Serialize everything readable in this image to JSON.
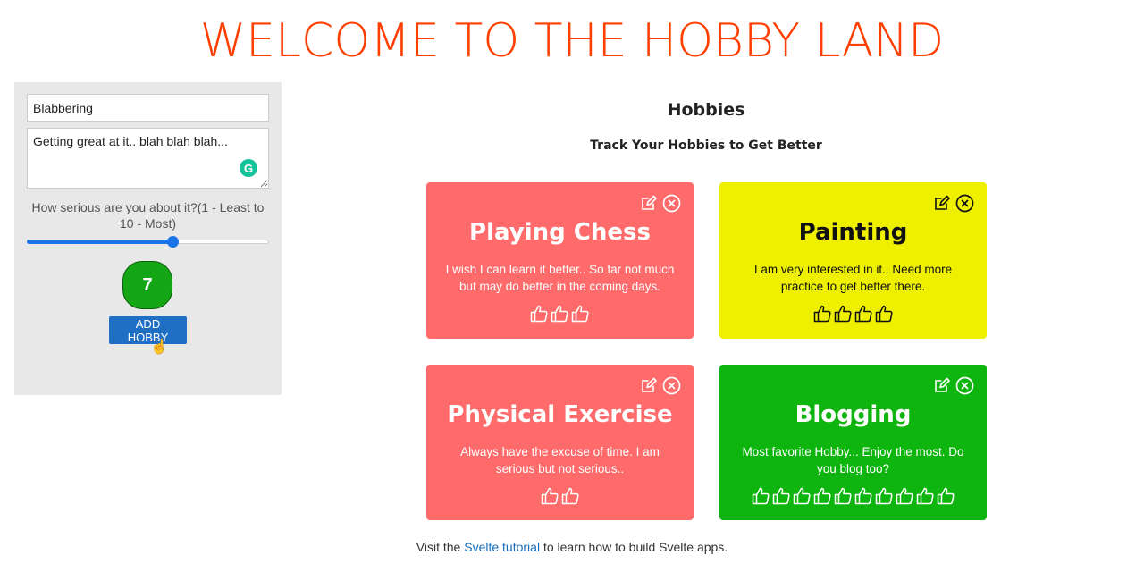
{
  "page": {
    "title": "WELCOME TO THE HOBBY LAND"
  },
  "form": {
    "name_value": "Blabbering",
    "description_value": "Getting great at it.. blah blah blah...",
    "serious_label": "How serious are you about it?(1 - Least to 10 - Most)",
    "slider": {
      "min": 1,
      "max": 10,
      "value": 7
    },
    "rating_value": "7",
    "add_button_label": "ADD HOBBY",
    "grammarly_icon": "G",
    "colors": {
      "bubble": "#14a614",
      "button": "#1f6fc5",
      "slider": "#1a73e8"
    }
  },
  "hobbies": {
    "heading": "Hobbies",
    "subheading": "Track Your Hobbies to Get Better",
    "cards": [
      {
        "title": "Playing Chess",
        "description": "I wish I can learn it better.. So far not much but may do better in the coming days.",
        "thumbs": 3,
        "bg_color": "#ff6b6b",
        "text_color": "#ffffff"
      },
      {
        "title": "Painting",
        "description": "I am very interested in it.. Need more practice to get better there.",
        "thumbs": 4,
        "bg_color": "#eef000",
        "text_color": "#111111"
      },
      {
        "title": "Physical Exercise",
        "description": "Always have the excuse of time. I am serious but not serious..",
        "thumbs": 2,
        "bg_color": "#ff6b6b",
        "text_color": "#ffffff"
      },
      {
        "title": "Blogging",
        "description": "Most favorite Hobby... Enjoy the most. Do you blog too?",
        "thumbs": 10,
        "bg_color": "#0fb50f",
        "text_color": "#ffffff"
      }
    ]
  },
  "footer": {
    "prefix": "Visit the ",
    "link_text": "Svelte tutorial",
    "suffix": " to learn how to build Svelte apps."
  }
}
